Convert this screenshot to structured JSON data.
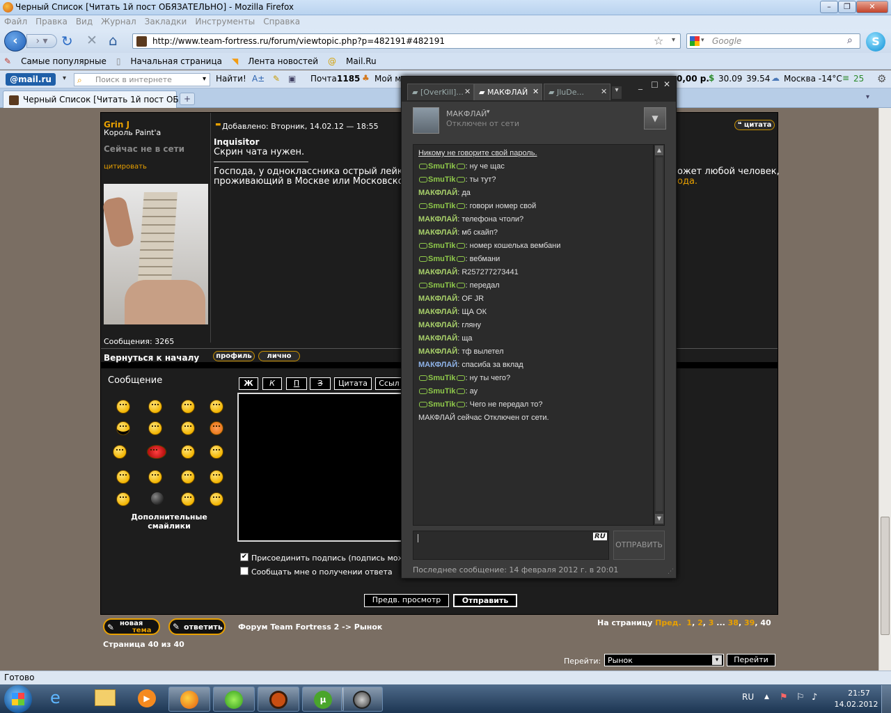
{
  "window": {
    "title": "Черный Список [Читать 1й пост ОБЯЗАТЕЛЬНО] - Mozilla Firefox"
  },
  "menu": [
    "Файл",
    "Правка",
    "Вид",
    "Журнал",
    "Закладки",
    "Инструменты",
    "Справка"
  ],
  "nav": {
    "url": "http://www.team-fortress.ru/forum/viewtopic.php?p=482191#482191",
    "search_placeholder": "Google"
  },
  "bookmarks": [
    "Самые популярные",
    "Начальная страница",
    "Лента новостей",
    "Mail.Ru"
  ],
  "mailbar": {
    "logo": "@mail.ru",
    "search_placeholder": "Поиск в интернете",
    "find": "Найти!",
    "mail": "Почта",
    "mail_count": "1185",
    "my": "Мой м",
    "money": "0,00 р.",
    "usd": "30.09",
    "eur": "39.54",
    "weather": "Москва -14°C",
    "traffic": "25"
  },
  "tab": {
    "label": "Черный Список [Читать 1й пост ОБ..."
  },
  "post": {
    "author": "Grin J",
    "rank": "Король Paint'a",
    "status": "Сейчас не в сети",
    "quote_link": "цитировать",
    "messages": "Сообщения: 3265",
    "date": "Добавлено: Вторник, 14.02.12 — 18:55",
    "quote_button": "цитата",
    "quoted_name": "Inquisitor",
    "quoted_text": "Скрин чата нужен.",
    "body_line1": "Господа, у одноклассника острый лейко:",
    "body_line1_end": "ожет любой человек,",
    "body_line2": "проживающий в Москве или Московской",
    "body_line2_end": "ода.",
    "back_top": "Вернуться к началу",
    "profile_btn": "профиль",
    "pm_btn": "лично"
  },
  "reply": {
    "title": "Сообщение",
    "tools": [
      "Ж",
      "К",
      "П",
      "З",
      "Цитата",
      "Ссыл"
    ],
    "more_smilies": "Дополнительные смайлики",
    "opt_signature": "Присоединить подпись (подпись можн",
    "opt_notify": "Сообщать мне о получении ответа",
    "preview": "Предв. просмотр",
    "submit": "Отправить"
  },
  "footer": {
    "new_topic_1": "новая",
    "new_topic_2": "тема",
    "reply": "ответить",
    "breadcrumb": "Форум Team Fortress 2 -> Рынок",
    "pages_label": "На страницу",
    "prev": "Пред.",
    "pages": [
      "1",
      ",",
      "2",
      ",",
      "3",
      " ... ",
      "38",
      ",",
      "39",
      ",",
      "40"
    ],
    "page_of": "Страница 40 из 40",
    "goto_label": "Перейти:",
    "goto_value": "Рынок",
    "goto_btn": "Перейти"
  },
  "steam": {
    "tabs": [
      "[OverKill]...",
      "МАКФЛАЙ",
      "JluDe..."
    ],
    "friend_name": "МАКФЛАЙ",
    "friend_status": "Отключен от сети",
    "warning": "Никому не говорите свой пароль.",
    "messages": [
      {
        "who": "SmuTik",
        "text": ": ну че щас",
        "kind": "s"
      },
      {
        "who": "SmuTik",
        "text": ": ты тут?",
        "kind": "s"
      },
      {
        "who": "МАКФЛАЙ",
        "text": ": да",
        "kind": "m"
      },
      {
        "who": "SmuTik",
        "text": ": говори номер свой",
        "kind": "s"
      },
      {
        "who": "МАКФЛАЙ",
        "text": ": телефона чтоли?",
        "kind": "m"
      },
      {
        "who": "МАКФЛАЙ",
        "text": ": мб скайп?",
        "kind": "m"
      },
      {
        "who": "SmuTik",
        "text": ": номер кошелька вембани",
        "kind": "s"
      },
      {
        "who": "SmuTik",
        "text": ": вебмани",
        "kind": "s"
      },
      {
        "who": "МАКФЛАЙ",
        "text": ": R257277273441",
        "kind": "m"
      },
      {
        "who": "SmuTik",
        "text": ": передал",
        "kind": "s"
      },
      {
        "who": "МАКФЛАЙ",
        "text": ": OF JR",
        "kind": "m"
      },
      {
        "who": "МАКФЛАЙ",
        "text": ": ЩА ОК",
        "kind": "m"
      },
      {
        "who": "МАКФЛАЙ",
        "text": ": гляну",
        "kind": "m"
      },
      {
        "who": "МАКФЛАЙ",
        "text": ": ща",
        "kind": "m"
      },
      {
        "who": "МАКФЛАЙ",
        "text": ": тф вылетел",
        "kind": "m"
      },
      {
        "who": "МАКФЛАЙ",
        "text": ": спасиба за вклад",
        "kind": "m2"
      },
      {
        "who": "SmuTik",
        "text": ": ну ты чего?",
        "kind": "s"
      },
      {
        "who": "SmuTik",
        "text": ": ау",
        "kind": "s"
      },
      {
        "who": "SmuTik",
        "text": ": Чего не передал то?",
        "kind": "s"
      }
    ],
    "offline_note": "МАКФЛАЙ сейчас Отключен от сети.",
    "lang": "RU",
    "send": "ОТПРАВИТЬ",
    "last_message": "Последнее сообщение: 14 февраля 2012 г. в 20:01"
  },
  "status": {
    "text": "Готово"
  },
  "tray": {
    "lang": "RU",
    "time": "21:57",
    "date": "14.02.2012"
  }
}
